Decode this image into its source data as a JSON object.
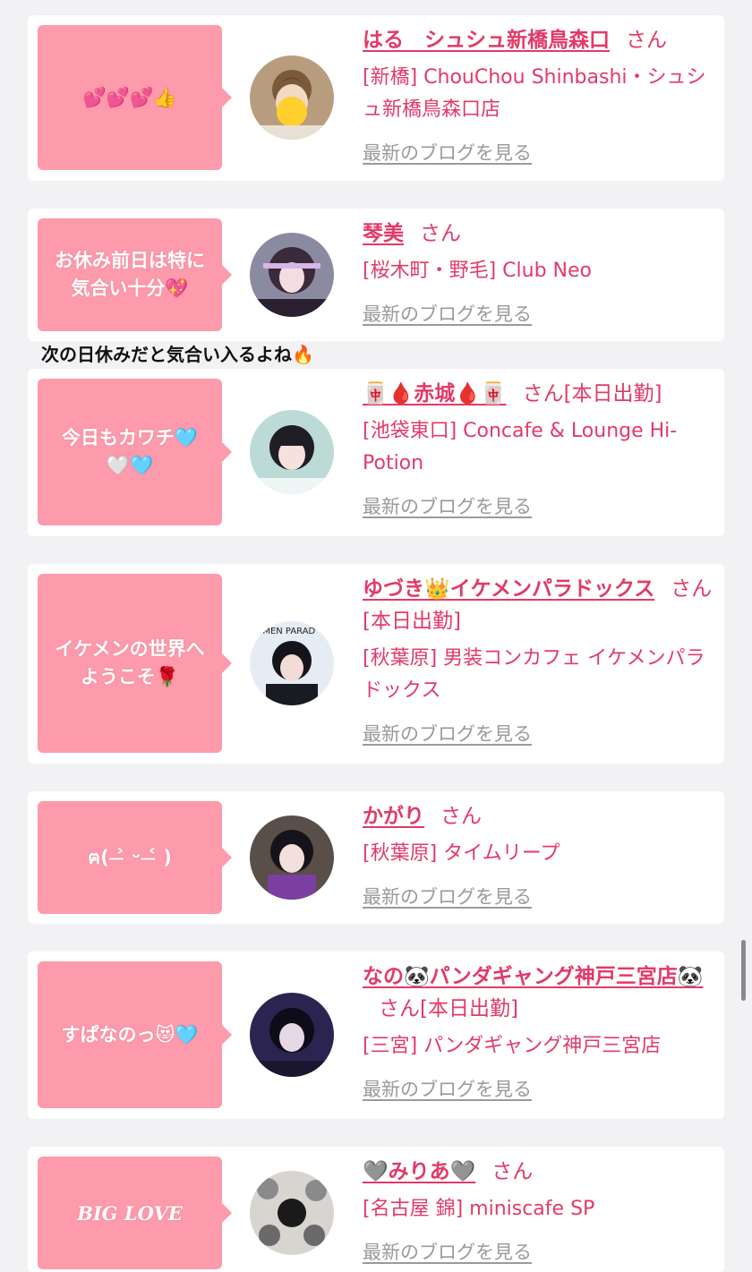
{
  "cards": [
    {
      "bubble": "💕💕💕👍",
      "name": "はる　シュシュ新橋鳥森口",
      "san": "さん",
      "suffix": "",
      "shop": "[新橋] ChouChou Shinbashi・シュシュ新橋鳥森口店",
      "blog": "最新のブログを見る",
      "avatar_icon": "avatar-photo"
    },
    {
      "bubble": "お休み前日は特に\n気合い十分💖",
      "name": "琴美",
      "san": "さん",
      "suffix": "",
      "shop": "[桜木町・野毛] Club Neo",
      "blog": "最新のブログを見る",
      "avatar_icon": "avatar-photo"
    },
    {
      "bubble": "今日もカワチ🩵\n🤍🩵",
      "name": "🀄🩸赤城🩸🀄",
      "san": "さん",
      "suffix": "[本日出勤]",
      "shop": "[池袋東口] Concafe & Lounge Hi-Potion",
      "blog": "最新のブログを見る",
      "avatar_icon": "avatar-photo"
    },
    {
      "bubble": "イケメンの世界へ\nようこそ🌹",
      "name": "ゆづき👑イケメンパラドックス",
      "san": "さん",
      "suffix": "[本日出勤]",
      "shop": "[秋葉原] 男装コンカフェ イケメンパラドックス",
      "blog": "最新のブログを見る",
      "avatar_icon": "avatar-photo"
    },
    {
      "bubble": "ฅ( ˃̶ ᵕ ˂̶ )",
      "name": "かがり",
      "san": "さん",
      "suffix": "",
      "shop": "[秋葉原] タイムリープ",
      "blog": "最新のブログを見る",
      "avatar_icon": "avatar-photo"
    },
    {
      "bubble": "すぱなのっ😻🩵",
      "name": "なの🐼パンダギャング神戸三宮店🐼",
      "san": "さん",
      "suffix": "[本日出勤]",
      "shop": "[三宮] パンダギャング神戸三宮店",
      "blog": "最新のブログを見る",
      "avatar_icon": "avatar-photo"
    },
    {
      "bubble": "BIG LOVE",
      "name": "🩶みりあ🩶",
      "san": "さん",
      "suffix": "",
      "shop": "[名古屋 錦] miniscafe SP",
      "blog": "最新のブログを見る",
      "avatar_icon": "avatar-photo"
    }
  ],
  "note": "次の日休みだと気合い入るよね🔥"
}
